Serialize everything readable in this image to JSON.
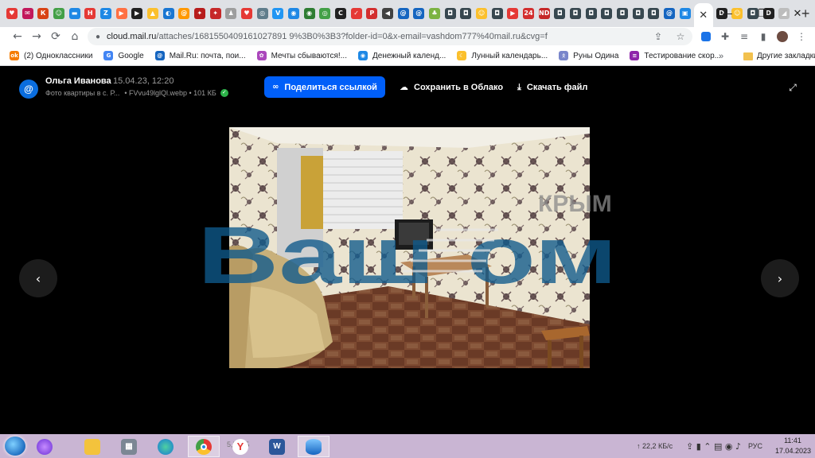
{
  "browser": {
    "tabs": [
      {
        "icon": "shield-icon",
        "color": "#e53935",
        "glyph": "♥"
      },
      {
        "icon": "mail-icon",
        "color": "#c2185b",
        "glyph": "✉"
      },
      {
        "icon": "k-icon",
        "color": "#d84315",
        "glyph": "К"
      },
      {
        "icon": "chat-icon",
        "color": "#43a047",
        "glyph": "☺"
      },
      {
        "icon": "flag-icon",
        "color": "#1e88e5",
        "glyph": "▬"
      },
      {
        "icon": "h-icon",
        "color": "#e53935",
        "glyph": "Н"
      },
      {
        "icon": "z-icon",
        "color": "#1e88e5",
        "glyph": "Z"
      },
      {
        "icon": "play-icon",
        "color": "#ff7043",
        "glyph": "▶"
      },
      {
        "icon": "video-icon",
        "color": "#212121",
        "glyph": "▶"
      },
      {
        "icon": "drive-icon",
        "color": "#fbc02d",
        "glyph": "▲"
      },
      {
        "icon": "edge-icon",
        "color": "#1976d2",
        "glyph": "◐"
      },
      {
        "icon": "mailru-icon",
        "color": "#ff9800",
        "glyph": "@"
      },
      {
        "icon": "emblem-icon",
        "color": "#b71c1c",
        "glyph": "✦"
      },
      {
        "icon": "emblem-icon",
        "color": "#c62828",
        "glyph": "✦"
      },
      {
        "icon": "pin-icon",
        "color": "#9e9e9e",
        "glyph": "♟"
      },
      {
        "icon": "heart-icon",
        "color": "#e53935",
        "glyph": "♥"
      },
      {
        "icon": "circle-icon",
        "color": "#607d8b",
        "glyph": "◎"
      },
      {
        "icon": "vk-icon",
        "color": "#2196f3",
        "glyph": "V"
      },
      {
        "icon": "web-icon",
        "color": "#1e88e5",
        "glyph": "◉"
      },
      {
        "icon": "chat-icon",
        "color": "#2e7d32",
        "glyph": "◉"
      },
      {
        "icon": "target-icon",
        "color": "#43a047",
        "glyph": "◎"
      },
      {
        "icon": "c-icon",
        "color": "#212121",
        "glyph": "C"
      },
      {
        "icon": "check-icon",
        "color": "#e53935",
        "glyph": "✓"
      },
      {
        "icon": "px-icon",
        "color": "#d32f2f",
        "glyph": "P"
      },
      {
        "icon": "speaker-icon",
        "color": "#424242",
        "glyph": "◀"
      },
      {
        "icon": "mailru-icon",
        "color": "#1565c0",
        "glyph": "@"
      },
      {
        "icon": "mailru-icon",
        "color": "#1565c0",
        "glyph": "@"
      },
      {
        "icon": "android-icon",
        "color": "#7cb342",
        "glyph": "♣"
      },
      {
        "icon": "ok-icon",
        "color": "#37474f",
        "glyph": "◘"
      },
      {
        "icon": "ok-icon",
        "color": "#37474f",
        "glyph": "◘"
      },
      {
        "icon": "smile-icon",
        "color": "#fbc02d",
        "glyph": "☺"
      },
      {
        "icon": "ok-icon",
        "color": "#37474f",
        "glyph": "◘"
      },
      {
        "icon": "youtube-icon",
        "color": "#e53935",
        "glyph": "▶"
      },
      {
        "icon": "news24-icon",
        "color": "#d32f2f",
        "glyph": "24"
      },
      {
        "icon": "nd-icon",
        "color": "#c62828",
        "glyph": "ND"
      },
      {
        "icon": "ok-icon",
        "color": "#37474f",
        "glyph": "◘"
      },
      {
        "icon": "ok-icon",
        "color": "#37474f",
        "glyph": "◘"
      },
      {
        "icon": "ok-icon",
        "color": "#37474f",
        "glyph": "◘"
      },
      {
        "icon": "ok-icon",
        "color": "#37474f",
        "glyph": "◘"
      },
      {
        "icon": "ok-icon",
        "color": "#37474f",
        "glyph": "◘"
      },
      {
        "icon": "ok-icon",
        "color": "#37474f",
        "glyph": "◘"
      },
      {
        "icon": "ok-icon",
        "color": "#37474f",
        "glyph": "◘"
      },
      {
        "icon": "mailru-icon",
        "color": "#1565c0",
        "glyph": "@"
      },
      {
        "icon": "image-icon",
        "color": "#1e88e5",
        "glyph": "▣"
      }
    ],
    "active_tab_close": "✕",
    "after_tabs": [
      {
        "icon": "d-icon",
        "color": "#212121",
        "glyph": "D"
      },
      {
        "icon": "smile-icon",
        "color": "#fbc02d",
        "glyph": "☺"
      },
      {
        "icon": "ok-icon",
        "color": "#37474f",
        "glyph": "◘"
      },
      {
        "icon": "d-icon",
        "color": "#212121",
        "glyph": "D"
      },
      {
        "icon": "triangle-icon",
        "color": "#bdbdbd",
        "glyph": "◢"
      }
    ],
    "new_tab": "+",
    "window_controls": {
      "minimize": "—",
      "maximize": "❐",
      "close": "✕"
    },
    "url_host": "cloud.mail.ru",
    "url_rest": "/attaches/1681550409161027891 9%3B0%3B3?folder-id=0&x-email=vashdom777%40mail.ru&cvg=f",
    "nav": {
      "back": "←",
      "forward": "→",
      "reload": "⟳",
      "home": "⌂",
      "lock": "🔒"
    }
  },
  "bookmarks": [
    {
      "label": "(2) Одноклассники",
      "icon": "odnoklassniki-icon",
      "color": "#f57c00",
      "glyph": "ok"
    },
    {
      "label": "Google",
      "icon": "google-icon",
      "color": "#4285f4",
      "glyph": "G"
    },
    {
      "label": "Mail.Ru: почта, пои...",
      "icon": "mailru-icon",
      "color": "#1565c0",
      "glyph": "@"
    },
    {
      "label": "Мечты сбываются!...",
      "icon": "dream-icon",
      "color": "#ab47bc",
      "glyph": "✿"
    },
    {
      "label": "Денежный календ...",
      "icon": "globe-icon",
      "color": "#1e88e5",
      "glyph": "◉"
    },
    {
      "label": "Лунный календарь...",
      "icon": "moon-icon",
      "color": "#fbc02d",
      "glyph": "☾"
    },
    {
      "label": "Руны Одина",
      "icon": "rune-icon",
      "color": "#7986cb",
      "glyph": "ᛟ"
    },
    {
      "label": "Тестирование скор...",
      "icon": "speedtest-icon",
      "color": "#8e24aa",
      "glyph": "≡"
    }
  ],
  "bookmarks_more": "»",
  "other_bookmarks": "Другие закладки",
  "viewer": {
    "avatar": "@",
    "author": "Ольга Иванова",
    "date": "15.04.23, 12:20",
    "folder": "Фото квартиры в с. Р...",
    "filename": "• FVvu49lglQl.webp • 101 КБ",
    "share_label": "Поделиться ссылкой",
    "save_label": "Сохранить в Облако",
    "download_label": "Скачать файл",
    "watermark_top": "КРЫМ",
    "watermark_main": "Ваш  ом",
    "prev": "‹",
    "next": "›"
  },
  "taskbar": {
    "download_status": "5,5 МБ",
    "tray_speed": "↑ 22,2 КБ/с",
    "lang": "РУС",
    "time": "11:41",
    "date": "17.04.2023"
  }
}
